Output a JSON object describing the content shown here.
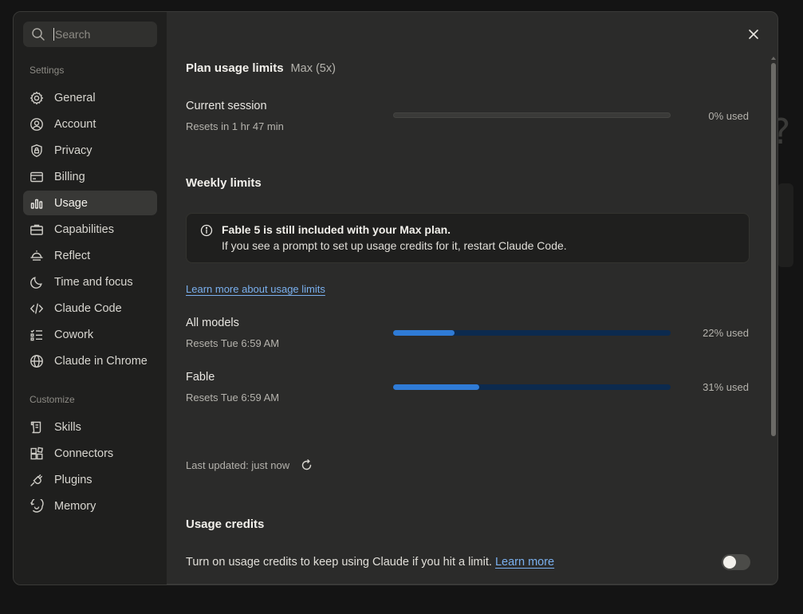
{
  "search": {
    "placeholder": "Search"
  },
  "sidebar": {
    "settings_label": "Settings",
    "items": [
      {
        "label": "General",
        "icon": "gear-icon"
      },
      {
        "label": "Account",
        "icon": "user-circle-icon"
      },
      {
        "label": "Privacy",
        "icon": "shield-lock-icon"
      },
      {
        "label": "Billing",
        "icon": "credit-card-icon"
      },
      {
        "label": "Usage",
        "icon": "bar-chart-icon",
        "active": true
      },
      {
        "label": "Capabilities",
        "icon": "briefcase-icon"
      },
      {
        "label": "Reflect",
        "icon": "sunset-icon"
      },
      {
        "label": "Time and focus",
        "icon": "moon-icon"
      },
      {
        "label": "Claude Code",
        "icon": "code-icon"
      },
      {
        "label": "Cowork",
        "icon": "checklist-icon"
      },
      {
        "label": "Claude in Chrome",
        "icon": "globe-icon"
      }
    ],
    "customize_label": "Customize",
    "customize_items": [
      {
        "label": "Skills",
        "icon": "scroll-icon"
      },
      {
        "label": "Connectors",
        "icon": "blocks-icon"
      },
      {
        "label": "Plugins",
        "icon": "plug-icon"
      },
      {
        "label": "Memory",
        "icon": "memory-icon"
      }
    ]
  },
  "main": {
    "plan_title": "Plan usage limits",
    "plan_name": "Max (5x)",
    "current_session": {
      "label": "Current session",
      "sub": "Resets in 1 hr 47 min",
      "percent": 0,
      "percent_label": "0% used"
    },
    "weekly_title": "Weekly limits",
    "notice": {
      "title": "Fable 5 is still included with your Max plan.",
      "body": "If you see a prompt to set up usage credits for it, restart Claude Code."
    },
    "learn_more_limits": "Learn more about usage limits",
    "all_models": {
      "label": "All models",
      "sub": "Resets Tue 6:59 AM",
      "percent": 22,
      "percent_label": "22% used"
    },
    "fable": {
      "label": "Fable",
      "sub": "Resets Tue 6:59 AM",
      "percent": 31,
      "percent_label": "31% used"
    },
    "last_updated": "Last updated: just now",
    "credits_title": "Usage credits",
    "credits_text": "Turn on usage credits to keep using Claude if you hit a limit.",
    "credits_link": "Learn more",
    "credits_enabled": false
  },
  "colors": {
    "accent": "#2f7bd6",
    "link": "#7ab0ef",
    "panel": "#2b2b2a",
    "sidebar": "#1f1f1e"
  }
}
